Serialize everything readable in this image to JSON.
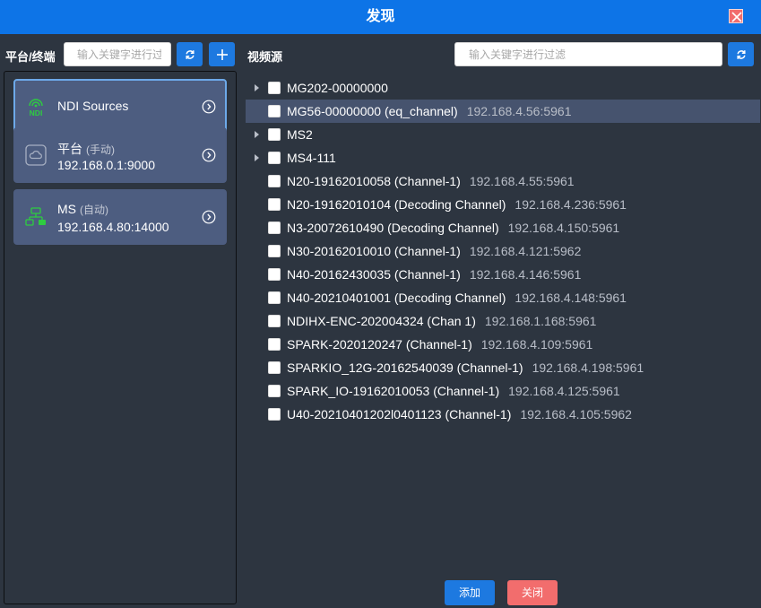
{
  "window": {
    "title": "发现"
  },
  "left": {
    "label": "平台/终端",
    "search_placeholder": "输入关键字进行过滤",
    "sources": [
      {
        "name": "NDI Sources",
        "tag": "",
        "address": ""
      },
      {
        "name": "平台",
        "tag": "(手动)",
        "address": "192.168.0.1:9000"
      },
      {
        "name": "MS",
        "tag": "(自动)",
        "address": "192.168.4.80:14000"
      }
    ],
    "ndi_logo_text": "NDI"
  },
  "right": {
    "label": "视频源",
    "search_placeholder": "输入关键字进行过滤",
    "items": [
      {
        "name": "MG202-00000000",
        "addr": ""
      },
      {
        "name": "MG56-00000000 (eq_channel)",
        "addr": "192.168.4.56:5961"
      },
      {
        "name": "MS2",
        "addr": ""
      },
      {
        "name": "MS4-111",
        "addr": ""
      },
      {
        "name": "N20-19162010058 (Channel-1)",
        "addr": "192.168.4.55:5961"
      },
      {
        "name": "N20-19162010104 (Decoding Channel)",
        "addr": "192.168.4.236:5961"
      },
      {
        "name": "N3-20072610490 (Decoding Channel)",
        "addr": "192.168.4.150:5961"
      },
      {
        "name": "N30-20162010010 (Channel-1)",
        "addr": "192.168.4.121:5962"
      },
      {
        "name": "N40-20162430035 (Channel-1)",
        "addr": "192.168.4.146:5961"
      },
      {
        "name": "N40-20210401001 (Decoding Channel)",
        "addr": "192.168.4.148:5961"
      },
      {
        "name": "NDIHX-ENC-202004324 (Chan 1)",
        "addr": "192.168.1.168:5961"
      },
      {
        "name": "SPARK-2020120247 (Channel-1)",
        "addr": "192.168.4.109:5961"
      },
      {
        "name": "SPARKIO_12G-20162540039 (Channel-1)",
        "addr": "192.168.4.198:5961"
      },
      {
        "name": "SPARK_IO-19162010053 (Channel-1)",
        "addr": "192.168.4.125:5961"
      },
      {
        "name": "U40-20210401202l0401123 (Channel-1)",
        "addr": "192.168.4.105:5962"
      }
    ]
  },
  "footer": {
    "add_label": "添加",
    "close_label": "关闭"
  },
  "colors": {
    "accent": "#0d74e7",
    "danger": "#f26d6d",
    "ndi_green": "#2ecc40",
    "background": "#2d3540",
    "card": "#4d5d80"
  }
}
